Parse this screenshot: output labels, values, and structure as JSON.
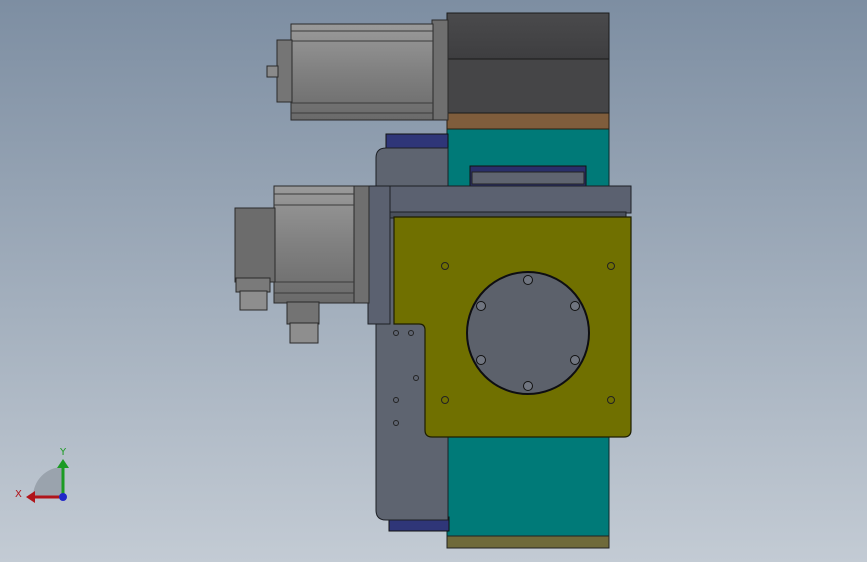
{
  "triad": {
    "x_label": "X",
    "y_label": "Y"
  },
  "colors": {
    "background_top": "#7d8ea2",
    "background_bottom": "#c3cbd4",
    "teal_body": "#007a78",
    "olive_plate": "#707000",
    "dark_block": "#4d4d4f",
    "brown_strip": "#7f5d3c",
    "steel": "#5e6470",
    "motor_grey": "#7c7c7c",
    "navy_part": "#2f3678",
    "axis_x": "#b0141a",
    "axis_y": "#1c9b24",
    "axis_z": "#2228c8"
  }
}
